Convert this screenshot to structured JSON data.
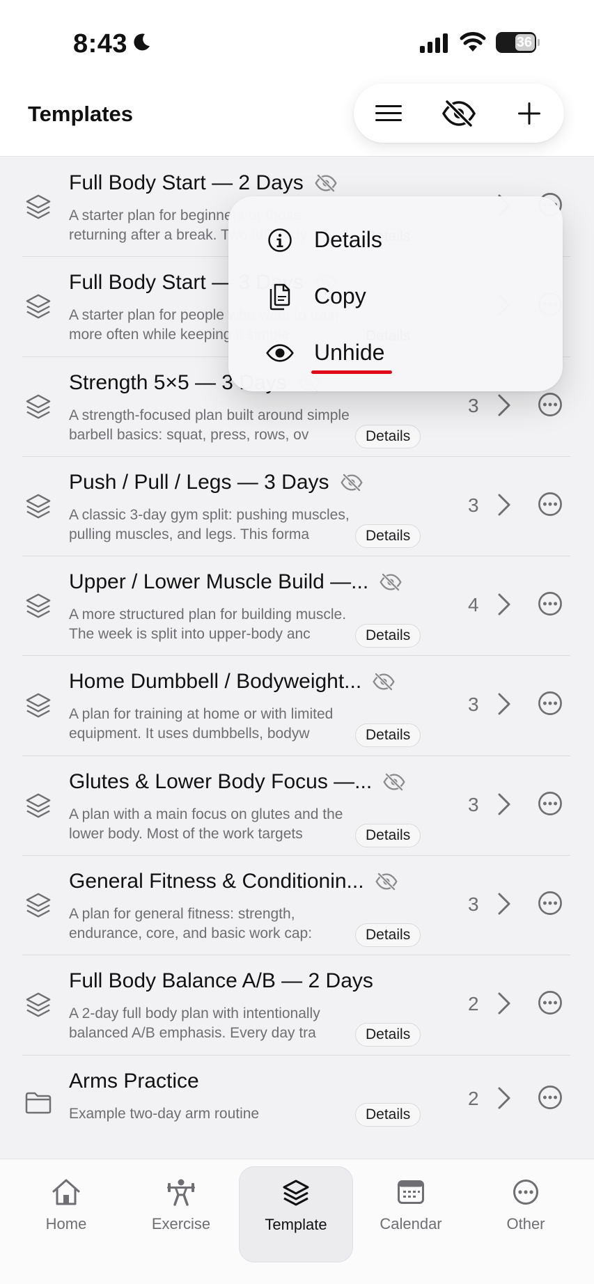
{
  "status": {
    "time": "8:43",
    "battery": "36"
  },
  "header": {
    "title": "Templates"
  },
  "menu": {
    "items": [
      {
        "label": "Details",
        "icon": "info-icon"
      },
      {
        "label": "Copy",
        "icon": "copy-icon"
      },
      {
        "label": "Unhide",
        "icon": "eye-icon"
      }
    ],
    "highlight_color": "#e00a1a"
  },
  "templates": [
    {
      "title": "Full Body Start — 2 Days",
      "line1": "A starter plan for beginners or those",
      "line2": "returning after a break. Two full-body",
      "count": "",
      "hidden": true
    },
    {
      "title": "Full Body Start — 3 Days",
      "line1": "A starter plan for people who want to train",
      "line2": "more often while keeping it simple.",
      "count": "",
      "hidden": true
    },
    {
      "title": "Strength 5×5 — 3 Days",
      "line1": "A strength-focused plan built around simple",
      "line2": "barbell basics: squat, press, rows, ov",
      "count": "3",
      "hidden": true
    },
    {
      "title": "Push / Pull / Legs — 3 Days",
      "line1": "A classic 3-day gym split: pushing muscles,",
      "line2": "pulling muscles, and legs. This forma",
      "count": "3",
      "hidden": true
    },
    {
      "title": "Upper / Lower Muscle Build —...",
      "line1": "A more structured plan for building muscle.",
      "line2": "The week is split into upper-body anc",
      "count": "4",
      "hidden": true
    },
    {
      "title": "Home Dumbbell / Bodyweight...",
      "line1": "A plan for training at home or with limited",
      "line2": "equipment. It uses dumbbells, bodyw",
      "count": "3",
      "hidden": true
    },
    {
      "title": "Glutes & Lower Body Focus —...",
      "line1": "A plan with a main focus on glutes and the",
      "line2": "lower body. Most of the work targets",
      "count": "3",
      "hidden": true
    },
    {
      "title": "General Fitness & Conditionin...",
      "line1": "A plan for general fitness: strength,",
      "line2": "endurance, core, and basic work cap:",
      "count": "3",
      "hidden": true
    },
    {
      "title": "Full Body Balance A/B — 2 Days",
      "line1": "A 2-day full body plan with intentionally",
      "line2": "balanced A/B emphasis. Every day tra",
      "count": "2",
      "hidden": false
    },
    {
      "title": "Arms Practice",
      "line1": "Example two-day arm routine",
      "line2": "",
      "count": "2",
      "hidden": false,
      "folder": true
    }
  ],
  "details_label": "Details",
  "tabs": [
    {
      "label": "Home",
      "icon": "house-icon"
    },
    {
      "label": "Exercise",
      "icon": "weightlifter-icon"
    },
    {
      "label": "Template",
      "icon": "stack-icon",
      "active": true
    },
    {
      "label": "Calendar",
      "icon": "calendar-icon"
    },
    {
      "label": "Other",
      "icon": "more-icon"
    }
  ]
}
